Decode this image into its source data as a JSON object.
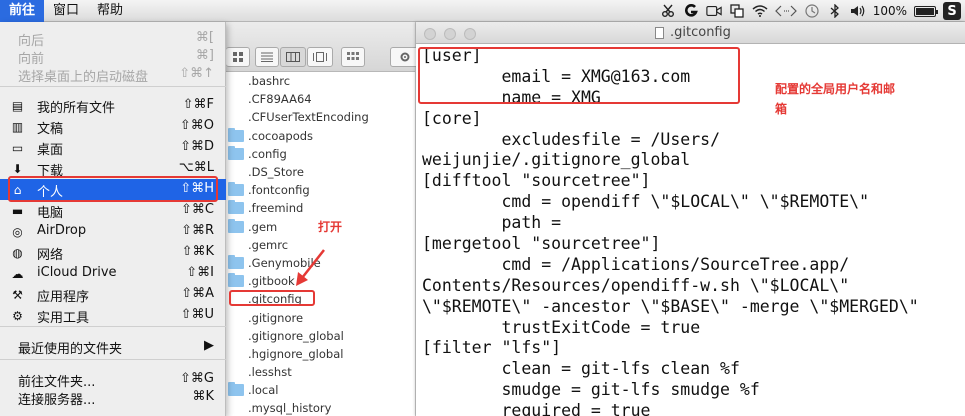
{
  "menubar": {
    "items": [
      "前往",
      "窗口",
      "帮助"
    ],
    "status_icons": [
      "scissors-icon",
      "g-app-icon",
      "facetime-icon",
      "sync-icon",
      "wifi-icon",
      "code-brackets-icon",
      "time-machine-icon",
      "bluetooth-icon",
      "volume-icon"
    ],
    "battery_percent": "100%",
    "app_logo": "S"
  },
  "go_menu": {
    "items": [
      {
        "label": "向后",
        "shortcut": "⌘[",
        "icon": "",
        "disabled": true
      },
      {
        "label": "向前",
        "shortcut": "⌘]",
        "icon": "",
        "disabled": true
      },
      {
        "label": "选择桌面上的启动磁盘",
        "shortcut": "⇧⌘↑",
        "icon": "",
        "disabled": true
      },
      {
        "label": "我的所有文件",
        "shortcut": "⇧⌘F",
        "icon": "all-files-icon"
      },
      {
        "label": "文稿",
        "shortcut": "⇧⌘O",
        "icon": "documents-icon"
      },
      {
        "label": "桌面",
        "shortcut": "⇧⌘D",
        "icon": "desktop-icon"
      },
      {
        "label": "下载",
        "shortcut": "⌥⌘L",
        "icon": "download-icon"
      },
      {
        "label": "个人",
        "shortcut": "⇧⌘H",
        "icon": "home-icon",
        "selected": true
      },
      {
        "label": "电脑",
        "shortcut": "⇧⌘C",
        "icon": "computer-icon"
      },
      {
        "label": "AirDrop",
        "shortcut": "⇧⌘R",
        "icon": "airdrop-icon"
      },
      {
        "label": "网络",
        "shortcut": "⇧⌘K",
        "icon": "network-icon"
      },
      {
        "label": "iCloud Drive",
        "shortcut": "⇧⌘I",
        "icon": "icloud-icon"
      },
      {
        "label": "应用程序",
        "shortcut": "⇧⌘A",
        "icon": "applications-icon"
      },
      {
        "label": "实用工具",
        "shortcut": "⇧⌘U",
        "icon": "utilities-icon"
      },
      {
        "label": "最近使用的文件夹",
        "shortcut": "▶",
        "icon": ""
      },
      {
        "label": "前往文件夹...",
        "shortcut": "⇧⌘G",
        "icon": ""
      },
      {
        "label": "连接服务器...",
        "shortcut": "⌘K",
        "icon": ""
      }
    ]
  },
  "finder": {
    "files": [
      ".bashrc",
      ".CF89AA64",
      ".CFUserTextEncoding",
      ".cocoapods",
      ".config",
      ".DS_Store",
      ".fontconfig",
      ".freemind",
      ".gem",
      ".gemrc",
      ".Genymobile",
      ".gitbook",
      ".gitconfig",
      ".gitignore",
      ".gitignore_global",
      ".hgignore_global",
      ".lesshst",
      ".local",
      ".mysql_history"
    ],
    "folders": [
      ".cocoapods",
      ".config",
      ".fontconfig",
      ".freemind",
      ".gem",
      ".Genymobile",
      ".gitbook",
      ".local"
    ]
  },
  "editor": {
    "title": ".gitconfig",
    "lines": [
      "[user]",
      "\temail = XMG@163.com",
      "\tname = XMG",
      "[core]",
      "\texcludesfile = /Users/",
      "weijunjie/.gitignore_global",
      "[difftool \"sourcetree\"]",
      "\tcmd = opendiff \\\"$LOCAL\\\" \\\"$REMOTE\\\"",
      "\tpath =",
      "[mergetool \"sourcetree\"]",
      "\tcmd = /Applications/SourceTree.app/",
      "Contents/Resources/opendiff-w.sh \\\"$LOCAL\\\"",
      "\\\"$REMOTE\\\" -ancestor \\\"$BASE\\\" -merge \\\"$MERGED\\\"",
      "\ttrustExitCode = true",
      "[filter \"lfs\"]",
      "\tclean = git-lfs clean %f",
      "\tsmudge = git-lfs smudge %f",
      "\trequired = true"
    ]
  },
  "annotations": {
    "open": "打开",
    "config_note_1": "配置的全局用户名和邮",
    "config_note_2": "箱",
    "accent_color": "#e53935"
  }
}
